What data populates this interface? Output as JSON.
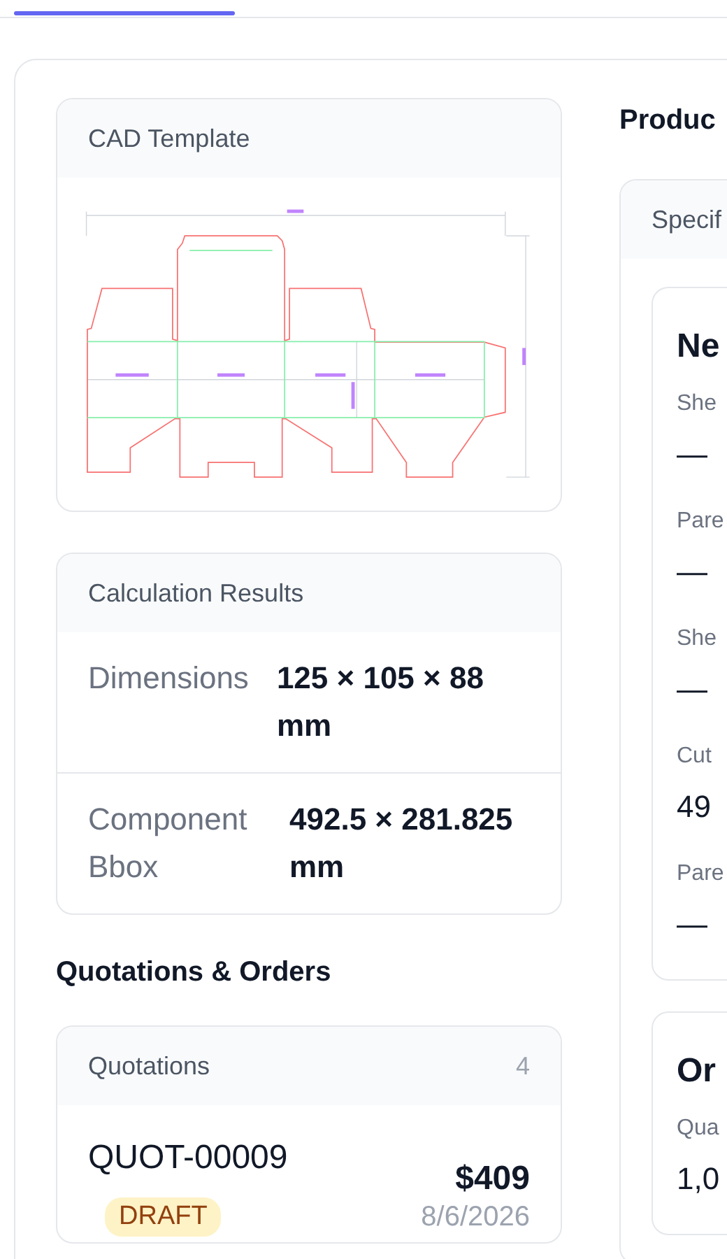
{
  "cad_template": {
    "title": "CAD Template"
  },
  "calculation_results": {
    "title": "Calculation Results",
    "rows": [
      {
        "label": "Dimensions",
        "value": "125 × 105 × 88 mm"
      },
      {
        "label": "Component Bbox",
        "value": "492.5 × 281.825 mm"
      }
    ]
  },
  "quotations_orders": {
    "title": "Quotations & Orders",
    "quotations": {
      "title": "Quotations",
      "count": "4",
      "items": [
        {
          "number": "QUOT-00009",
          "status": "DRAFT",
          "amount": "$409",
          "date": "8/6/2026"
        }
      ]
    }
  },
  "product": {
    "title": "Produc",
    "specifications": {
      "tab": "Specif",
      "cards": [
        {
          "title": "Ne",
          "fields": [
            {
              "label": "She",
              "value": "—"
            },
            {
              "label": "Pare",
              "value": "—"
            },
            {
              "label": "She",
              "value": "—"
            },
            {
              "label": "Cut",
              "value": "49"
            },
            {
              "label": "Pare",
              "value": "—"
            }
          ]
        },
        {
          "title": "Or",
          "fields": [
            {
              "label": "Qua",
              "value": "1,0"
            }
          ]
        }
      ]
    }
  }
}
